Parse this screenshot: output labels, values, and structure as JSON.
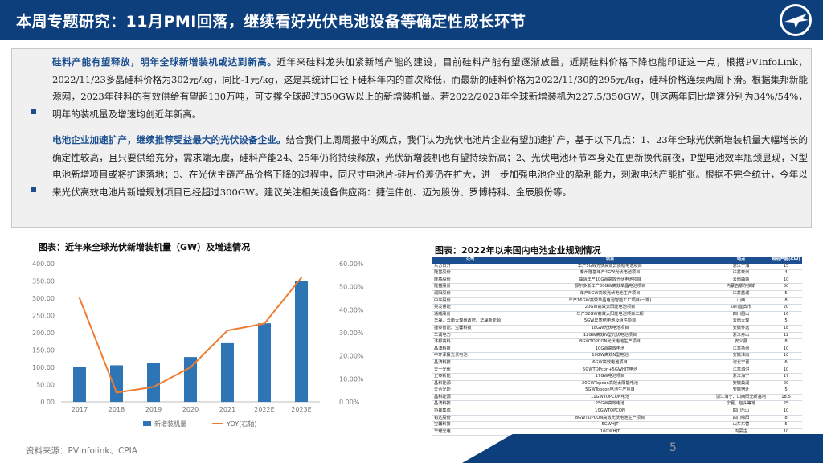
{
  "header": {
    "title": "本周专题研究：11月PMI回落，继续看好光伏电池设备等确定性成长环节"
  },
  "summary": {
    "para1_lead": "硅料产能有望释放，明年全球新增装机或达到新高。",
    "para1_body": "近年来硅料龙头加紧新增产能的建设，目前硅料产能有望逐渐放量，近期硅料价格下降也能印证这一点，根据PVInfoLink，2022/11/23多晶硅料价格为302元/kg，同比-1元/kg，这是其统计口径下硅料年内的首次降低，而最新的硅料价格为2022/11/30的295元/kg，硅料价格连续两周下滑。根据集邦新能源网，2023年硅料的有效供给有望超130万吨，可支撑全球超过350GW以上的新增装机量。若2022/2023年全球新增装机为227.5/350GW，则这两年同比增速分别为34%/54%，明年的装机量及增速均创近年新高。",
    "para2_lead": "电池企业加速扩产，继续推荐受益最大的光伏设备企业。",
    "para2_body": "结合我们上周周报中的观点，我们认为光伏电池片企业有望加速扩产，基于以下几点：1、23年全球光伏新增装机量大幅增长的确定性较高，且只要供给充分，需求端无虞，硅料产能24、25年仍将持续释放，光伏新增装机也有望持续新高；2、光伏电池环节本身处在更新换代前夜，P型电池效率瓶颈显现，N型电池新增项目或将扩速落地；3、在光伏主链产品价格下降的过程中，同尺寸电池片-硅片价差仍在扩大，进一步加强电池企业的盈利能力，刺激电池产能扩张。根据不完全统计，今年以来光伏高效电池片新增规划项目已经超过300GW。建议关注相关设备供应商：捷佳伟创、迈为股份、罗博特科、金辰股份等。"
  },
  "chart1": {
    "title": "图表：近年来全球光伏新增装机量（GW）及增速情况"
  },
  "chart_data": {
    "type": "bar",
    "categories": [
      "2017",
      "2018",
      "2019",
      "2020",
      "2021",
      "2022E",
      "2023E"
    ],
    "series": [
      {
        "name": "新增装机量",
        "kind": "bar",
        "axis": "left",
        "values": [
          102,
          106,
          113,
          130,
          170,
          227.5,
          350
        ],
        "color": "#2e75b6"
      },
      {
        "name": "YOY(右轴)",
        "kind": "line",
        "axis": "right",
        "values": [
          0.45,
          0.04,
          0.065,
          0.15,
          0.31,
          0.34,
          0.54
        ],
        "color": "#ed7d31"
      }
    ],
    "left_ticks": [
      "0.00",
      "50.00",
      "100.00",
      "150.00",
      "200.00",
      "250.00",
      "300.00",
      "350.00",
      "400.00"
    ],
    "right_ticks": [
      "0.00%",
      "10.00%",
      "20.00%",
      "30.00%",
      "40.00%",
      "50.00%",
      "60.00%"
    ],
    "ylim": [
      0,
      400
    ],
    "y2lim": [
      0,
      0.6
    ],
    "legend_position": "bottom"
  },
  "table": {
    "title": "图表：2022年以来国内电池企业规划情况",
    "columns": [
      "公司",
      "项目",
      "地点",
      "规划产能(GW)"
    ],
    "rows": [
      [
        "东方日升",
        "年产5GW光伏高效异质结电池项目",
        "浙江宁海",
        "15"
      ],
      [
        "隆基股份",
        "泰州隆基年产4GW光伏电池项目",
        "江苏泰州",
        "4"
      ],
      [
        "隆基股份",
        "曲靖年产10GW高效光伏电池项目",
        "云南曲靖",
        "10"
      ],
      [
        "隆基股份",
        "鄂尔多斯年产30GW高效单晶电池项目",
        "内蒙古鄂尔多斯",
        "30"
      ],
      [
        "润阳股份",
        "年产5GW高效光伏电池生产项目",
        "江苏盐城",
        "5"
      ],
      [
        "中来股份",
        "年产16GW高效单晶电池智能工厂项目(一期)",
        "山西",
        "8"
      ],
      [
        "英发睿能",
        "20GW高效太阳能电池项目",
        "四川宜宾市",
        "20"
      ],
      [
        "通威股份",
        "年产32GW高效太阳能电池项目二期",
        "四川眉山",
        "16"
      ],
      [
        "华晟、云南大理州政府、华晟新能源",
        "5GW异质结电池及组件项目",
        "云南大理",
        "5"
      ],
      [
        "捷泰智能、宝馨科技",
        "18GW光伏电池项目",
        "安徽怀远",
        "18"
      ],
      [
        "华润电力",
        "12GW高效N型光伏电池项目",
        "浙江舟山",
        "12"
      ],
      [
        "沐邦高科",
        "8GWTOPCON光伏电池生产项目",
        "安义县",
        "8"
      ],
      [
        "晶澳科技",
        "10GW高效电池",
        "江苏扬州",
        "10"
      ],
      [
        "中环泽投光伏电池",
        "10GW高效N型电池",
        "安徽淮南",
        "10"
      ],
      [
        "晶澳科技",
        "6GW高效电池项目",
        "河北宁晋",
        "6"
      ],
      [
        "天一光伏",
        "5GWTOPcon+5GWHJT电池",
        "江苏泗洪",
        "10"
      ],
      [
        "正泰新能",
        "17GW电池项目",
        "浙江海宁",
        "17"
      ],
      [
        "晶科能源",
        "20GWTopcon高效太阳能电池",
        "安徽巢湖",
        "20"
      ],
      [
        "天合光能",
        "5GWTopcon电池生产项目",
        "安徽宿迁",
        "5"
      ],
      [
        "晶科能源",
        "11GWTOPCON电池",
        "浙江海宁、山西阳光新基地",
        "18.5"
      ],
      [
        "晶澳科技",
        "25GW高效电池",
        "宁夏、包头等地",
        "25"
      ],
      [
        "协鑫集成",
        "10GWTOPCON",
        "四川乐山",
        "10"
      ],
      [
        "钧达股份",
        "8GWTOPCON高效光伏电池生产项目",
        "四川绵阳",
        "8"
      ],
      [
        "宝馨科技",
        "5GWHJT",
        "山东东营",
        "5"
      ],
      [
        "华耀光电",
        "10GWHJT",
        "内蒙古",
        "10"
      ]
    ]
  },
  "footer": {
    "source": "资料来源：PVInfolink、CPIA",
    "page": "5"
  }
}
